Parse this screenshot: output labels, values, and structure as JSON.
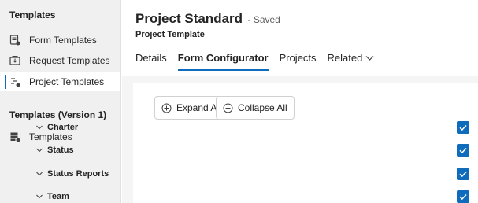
{
  "sidebar": {
    "section1_title": "Templates",
    "items": [
      {
        "label": "Form Templates",
        "icon": "form-template-icon"
      },
      {
        "label": "Request Templates",
        "icon": "request-template-icon"
      },
      {
        "label": "Project Templates",
        "icon": "project-template-icon",
        "selected": true
      }
    ],
    "section2_title": "Templates (Version 1)",
    "items2": [
      {
        "label": "Templates",
        "icon": "template-icon"
      }
    ]
  },
  "header": {
    "title": "Project Standard",
    "status": "- Saved",
    "subtitle": "Project Template"
  },
  "tabs": [
    {
      "label": "Details"
    },
    {
      "label": "Form Configurator",
      "active": true
    },
    {
      "label": "Projects"
    },
    {
      "label": "Related"
    }
  ],
  "actions": {
    "expand_all": "Expand All",
    "collapse_all": "Collapse All"
  },
  "sections": [
    {
      "label": "Charter",
      "checked": true
    },
    {
      "label": "Status",
      "checked": true
    },
    {
      "label": "Status Reports",
      "checked": true
    },
    {
      "label": "Team",
      "checked": true
    }
  ],
  "colors": {
    "accent": "#0f6cbd",
    "sidebar_bg": "#f0f0f0"
  }
}
